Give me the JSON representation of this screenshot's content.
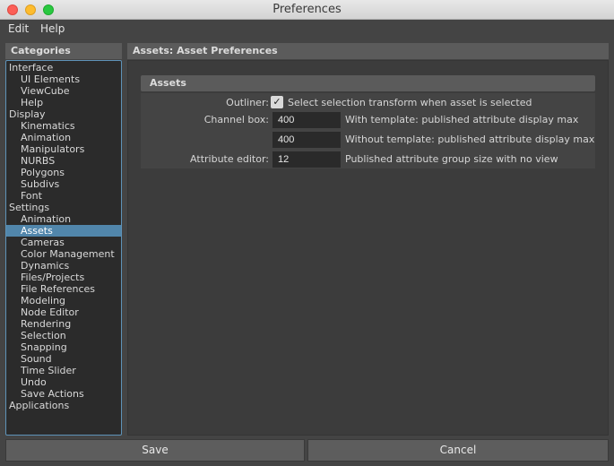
{
  "window": {
    "title": "Preferences"
  },
  "menubar": {
    "items": [
      "Edit",
      "Help"
    ]
  },
  "categories": {
    "header": "Categories",
    "selected": "Assets",
    "items": [
      {
        "label": "Interface",
        "level": 0
      },
      {
        "label": "UI Elements",
        "level": 1
      },
      {
        "label": "ViewCube",
        "level": 1
      },
      {
        "label": "Help",
        "level": 1
      },
      {
        "label": "Display",
        "level": 0
      },
      {
        "label": "Kinematics",
        "level": 1
      },
      {
        "label": "Animation",
        "level": 1
      },
      {
        "label": "Manipulators",
        "level": 1
      },
      {
        "label": "NURBS",
        "level": 1
      },
      {
        "label": "Polygons",
        "level": 1
      },
      {
        "label": "Subdivs",
        "level": 1
      },
      {
        "label": "Font",
        "level": 1
      },
      {
        "label": "Settings",
        "level": 0
      },
      {
        "label": "Animation",
        "level": 1
      },
      {
        "label": "Assets",
        "level": 1,
        "selected": true
      },
      {
        "label": "Cameras",
        "level": 1
      },
      {
        "label": "Color Management",
        "level": 1
      },
      {
        "label": "Dynamics",
        "level": 1
      },
      {
        "label": "Files/Projects",
        "level": 1
      },
      {
        "label": "File References",
        "level": 1
      },
      {
        "label": "Modeling",
        "level": 1
      },
      {
        "label": "Node Editor",
        "level": 1
      },
      {
        "label": "Rendering",
        "level": 1
      },
      {
        "label": "Selection",
        "level": 1
      },
      {
        "label": "Snapping",
        "level": 1
      },
      {
        "label": "Sound",
        "level": 1
      },
      {
        "label": "Time Slider",
        "level": 1
      },
      {
        "label": "Undo",
        "level": 1
      },
      {
        "label": "Save Actions",
        "level": 1
      },
      {
        "label": "Applications",
        "level": 0
      }
    ]
  },
  "preferences": {
    "header": "Assets: Asset Preferences",
    "section": "Assets",
    "outliner": {
      "label": "Outliner:",
      "checked": true,
      "check_glyph": "✓",
      "text": "Select selection transform when asset is selected"
    },
    "channel_box": {
      "label": "Channel box:",
      "with_template_value": "400",
      "with_template_text": "With template: published attribute display max",
      "without_template_value": "400",
      "without_template_text": "Without template: published attribute display max"
    },
    "attribute_editor": {
      "label": "Attribute editor:",
      "value": "12",
      "text": "Published attribute group size with no view"
    }
  },
  "buttons": {
    "save": "Save",
    "cancel": "Cancel"
  },
  "colors": {
    "selection": "#5186ab",
    "list_border": "#5e93b8"
  }
}
